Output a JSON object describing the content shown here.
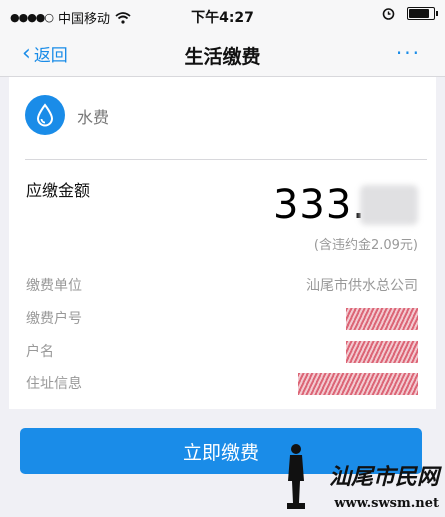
{
  "status_bar": {
    "carrier": "中国移动",
    "time": "下午4:27",
    "signal_icon": "signal-dots-icon",
    "wifi_icon": "wifi-icon",
    "alarm_icon": "alarm-icon",
    "battery_icon": "battery-icon"
  },
  "nav": {
    "back_label": "返回",
    "title": "生活缴费",
    "more_label": "···"
  },
  "service": {
    "icon": "water-drop-icon",
    "name": "水费"
  },
  "bill": {
    "amount_label": "应缴金额",
    "amount_value": "333.",
    "late_fee_note": "(含违约金2.09元)"
  },
  "details": [
    {
      "label": "缴费单位",
      "value": "汕尾市供水总公司"
    },
    {
      "label": "缴费户号",
      "value": ""
    },
    {
      "label": "户名",
      "value": ""
    },
    {
      "label": "住址信息",
      "value": ""
    }
  ],
  "action": {
    "pay_label": "立即缴费"
  },
  "watermark": {
    "text": "汕尾市民网",
    "url": "www.swsm.net"
  },
  "colors": {
    "accent": "#1a8ce8",
    "background": "#f0f0f5"
  }
}
